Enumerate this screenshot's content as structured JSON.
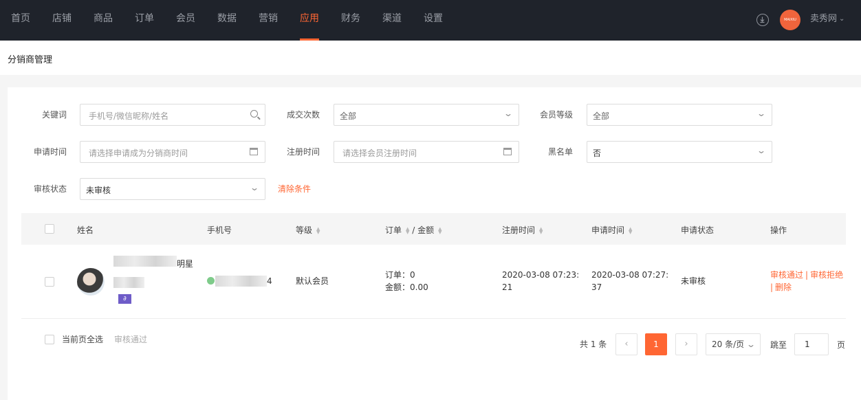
{
  "nav": {
    "items": [
      "首页",
      "店铺",
      "商品",
      "订单",
      "会员",
      "数据",
      "营销",
      "应用",
      "财务",
      "渠道",
      "设置"
    ],
    "active_index": 7,
    "shop_name": "卖秀网",
    "logo_text": "MAIXIU",
    "accent_color": "#ff6633"
  },
  "page": {
    "title": "分销商管理"
  },
  "filters": {
    "keyword": {
      "label": "关键词",
      "placeholder": "手机号/微信昵称/姓名"
    },
    "deal_count": {
      "label": "成交次数",
      "value": "全部"
    },
    "member_level": {
      "label": "会员等级",
      "value": "全部"
    },
    "apply_time": {
      "label": "申请时间",
      "placeholder": "请选择申请成为分销商时间"
    },
    "register_time": {
      "label": "注册时间",
      "placeholder": "请选择会员注册时间"
    },
    "blacklist": {
      "label": "黑名单",
      "value": "否"
    },
    "audit_status": {
      "label": "审核状态",
      "value": "未审核"
    },
    "clear_label": "清除条件"
  },
  "table": {
    "headers": {
      "name": "姓名",
      "phone": "手机号",
      "level": "等级",
      "order": "订单",
      "slash": "/",
      "amount": "金额",
      "register_time": "注册时间",
      "apply_time": "申请时间",
      "apply_status": "申请状态",
      "actions": "操作"
    },
    "rows": [
      {
        "name_suffix": "明星",
        "phone_suffix": "4",
        "level": "默认会员",
        "order_label": "订单：",
        "order_value": "0",
        "amount_label": "金额：",
        "amount_value": "0.00",
        "register_time_line1": "2020-03-08 07:23:",
        "register_time_line2": "21",
        "apply_time_line1": "2020-03-08 07:27:",
        "apply_time_line2": "37",
        "status": "未审核",
        "action_approve": "审核通过",
        "action_reject": "审核拒绝",
        "action_delete": "删除",
        "separator": "|"
      }
    ]
  },
  "footer": {
    "select_all_label": "当前页全选",
    "batch_approve_label": "审核通过",
    "total_text": "共 1 条",
    "prev": "‹",
    "current_page": "1",
    "next": "›",
    "page_size": "20 条/页",
    "jump_label": "跳至",
    "jump_value": "1",
    "page_unit": "页"
  }
}
